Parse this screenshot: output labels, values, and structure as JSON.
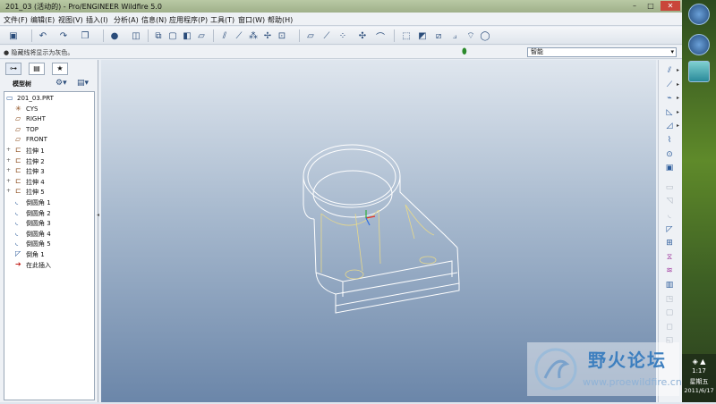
{
  "window": {
    "title": "201_03 (活动的) - Pro/ENGINEER Wildfire 5.0",
    "minimize": "–",
    "maximize": "□",
    "close": "✕"
  },
  "menu": [
    "文件(F)",
    "编辑(E)",
    "视图(V)",
    "插入(I)",
    "分析(A)",
    "信息(N)",
    "应用程序(P)",
    "工具(T)",
    "窗口(W)",
    "帮助(H)"
  ],
  "toolbar_icons": [
    "save-icon",
    "undo-icon",
    "redo-icon",
    "copy-icon",
    "shading-icon",
    "view-icon",
    "repaint-icon",
    "refit-icon",
    "orient-icon",
    "wireframe-icon",
    "hidden-line-icon",
    "no-hidden-icon",
    "shaded-icon",
    "plane-display-icon",
    "axis-display-icon",
    "point-display-icon",
    "csys-display-icon",
    "annotation-display-icon",
    "datum-plane-icon",
    "datum-axis-icon",
    "datum-point-icon",
    "datum-csys-icon",
    "analysis-icon",
    "sketch-icon"
  ],
  "status": {
    "message": "● 隐藏线将显示为灰色。",
    "filter_value": "智能"
  },
  "panel": {
    "tabs": [
      "tree-tab",
      "folder-tab",
      "favorites-tab"
    ],
    "title": "模型树"
  },
  "tree": [
    {
      "label": "201_03.PRT",
      "icon": "part-icon",
      "expand": "",
      "level": 0
    },
    {
      "label": "CYS",
      "icon": "csys-icon",
      "expand": "",
      "level": 1
    },
    {
      "label": "RIGHT",
      "icon": "datum-plane-icon",
      "expand": "",
      "level": 1
    },
    {
      "label": "TOP",
      "icon": "datum-plane-icon",
      "expand": "",
      "level": 1
    },
    {
      "label": "FRONT",
      "icon": "datum-plane-icon",
      "expand": "",
      "level": 1
    },
    {
      "label": "拉伸 1",
      "icon": "extrude-icon",
      "expand": "+",
      "level": 1
    },
    {
      "label": "拉伸 2",
      "icon": "extrude-icon",
      "expand": "+",
      "level": 1
    },
    {
      "label": "拉伸 3",
      "icon": "extrude-icon",
      "expand": "+",
      "level": 1
    },
    {
      "label": "拉伸 4",
      "icon": "extrude-icon",
      "expand": "+",
      "level": 1
    },
    {
      "label": "拉伸 5",
      "icon": "extrude-icon",
      "expand": "+",
      "level": 1
    },
    {
      "label": "倒圆角 1",
      "icon": "round-icon",
      "expand": "",
      "level": 1
    },
    {
      "label": "倒圆角 2",
      "icon": "round-icon",
      "expand": "",
      "level": 1
    },
    {
      "label": "倒圆角 3",
      "icon": "round-icon",
      "expand": "",
      "level": 1
    },
    {
      "label": "倒圆角 4",
      "icon": "round-icon",
      "expand": "",
      "level": 1
    },
    {
      "label": "倒圆角 5",
      "icon": "round-icon",
      "expand": "",
      "level": 1
    },
    {
      "label": "倒角 1",
      "icon": "chamfer-icon",
      "expand": "",
      "level": 1
    },
    {
      "label": "在此插入",
      "icon": "insert-here-icon",
      "expand": "",
      "level": 1
    }
  ],
  "right_tools": [
    "datum-plane-tool-icon",
    "datum-axis-tool-icon",
    "sketch-tool-icon",
    "extrude-tool-icon",
    "revolve-tool-icon",
    "sweep-tool-icon",
    "hole-tool-icon",
    "shell-tool-icon",
    "rib-tool-icon",
    "draft-tool-icon",
    "round-tool-icon",
    "chamfer-tool-icon",
    "pattern-tool-icon",
    "mirror-tool-icon",
    "merge-tool-icon",
    "trim-tool-icon",
    "extend-tool-icon",
    "offset-tool-icon",
    "thicken-tool-icon",
    "solidify-tool-icon"
  ],
  "taskbar": {
    "time": "1:17",
    "weekday": "星期五",
    "date": "2011/6/17"
  },
  "watermark": {
    "text": "野火论坛",
    "url": "www.proewildfire.cn"
  },
  "colors": {
    "viewport_top": "#dfe6ee",
    "viewport_bottom": "#6b86a9",
    "model_edge": "#ffffff",
    "model_hidden": "#e8d98a"
  }
}
